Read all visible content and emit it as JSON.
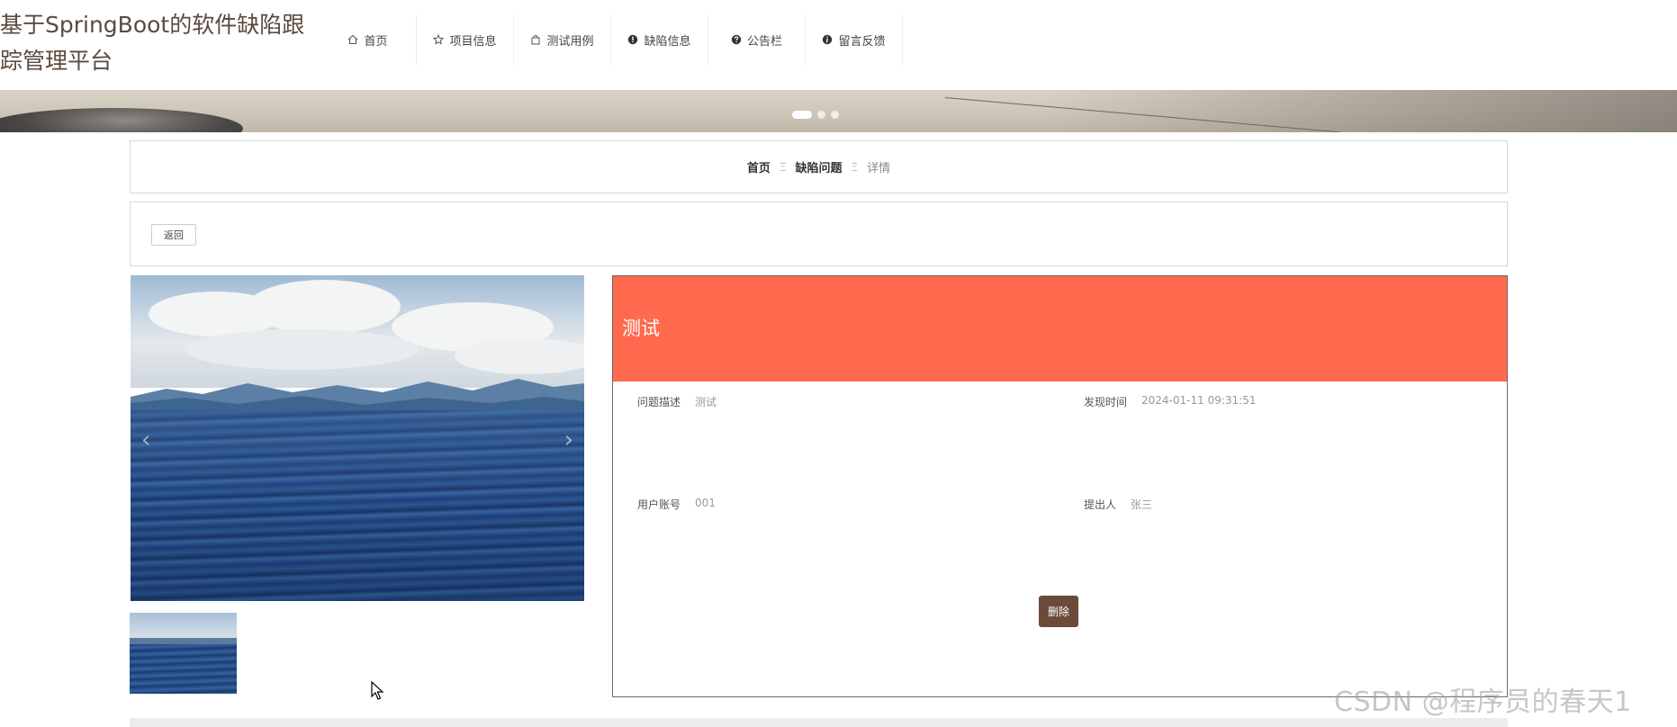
{
  "header": {
    "site_title": "基于SpringBoot的软件缺陷跟踪管理平台",
    "nav": [
      {
        "label": "首页",
        "icon": "home-icon"
      },
      {
        "label": "项目信息",
        "icon": "star-icon"
      },
      {
        "label": "测试用例",
        "icon": "bag-icon"
      },
      {
        "label": "缺陷信息",
        "icon": "exclamation-icon"
      },
      {
        "label": "公告栏",
        "icon": "question-icon"
      },
      {
        "label": "留言反馈",
        "icon": "info-icon"
      }
    ]
  },
  "banner": {
    "active_slide": 1,
    "slide_count": 3
  },
  "breadcrumb": {
    "home": "首页",
    "section": "缺陷问题",
    "current": "详情",
    "separator": "Ξ"
  },
  "actions": {
    "back_label": "返回",
    "delete_label": "删除"
  },
  "gallery": {
    "prev": "‹",
    "next": "›"
  },
  "detail": {
    "title": "测试",
    "fields": {
      "description_label": "问题描述",
      "description_value": "测试",
      "found_time_label": "发现时间",
      "found_time_value": "2024-01-11 09:31:51",
      "account_label": "用户账号",
      "account_value": "001",
      "submitter_label": "提出人",
      "submitter_value": "张三"
    }
  },
  "watermark": "CSDN @程序员的春天1",
  "colors": {
    "header_accent": "#ff6a4f",
    "delete_button": "#6b4a38",
    "title_text": "#5b4a3e"
  }
}
